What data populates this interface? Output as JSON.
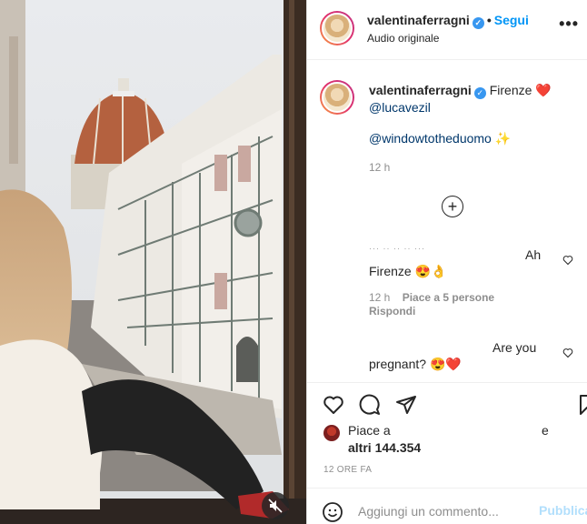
{
  "header": {
    "username": "valentinaferragni",
    "separator": "•",
    "follow_label": "Segui",
    "subtitle": "Audio originale",
    "more_label": "•••"
  },
  "caption": {
    "username": "valentinaferragni",
    "text": "Firenze",
    "heart": "❤️",
    "mention1": "@lucavezil",
    "mention2": "@windowtotheduomo",
    "sparkle": "✨",
    "time": "12 h"
  },
  "load_more": "+",
  "comments": [
    {
      "username": "··· ·· ·· ·· ···",
      "text_top": "Ah",
      "text_bottom": "Firenze 😍👌",
      "time": "12 h",
      "likes": "Piace a 5 persone",
      "reply": "Rispondi"
    },
    {
      "text_top": "Are you",
      "text_bottom": "pregnant? 😍❤️"
    }
  ],
  "likes": {
    "prefix": "Piace a",
    "suffix": "e",
    "others": "altri 144.354"
  },
  "post_time": "12 ORE FA",
  "add_comment": {
    "placeholder": "Aggiungi un commento...",
    "publish_label": "Pubblica"
  },
  "icons": [
    "heart-icon",
    "comment-icon",
    "share-icon",
    "bookmark-icon",
    "emoji-icon",
    "mute-icon",
    "verified-icon",
    "plus-icon"
  ],
  "colors": {
    "accent": "#0095f6",
    "verified": "#3897f0",
    "muted": "#8e8e8e",
    "publish_disabled": "#b2dffc"
  }
}
